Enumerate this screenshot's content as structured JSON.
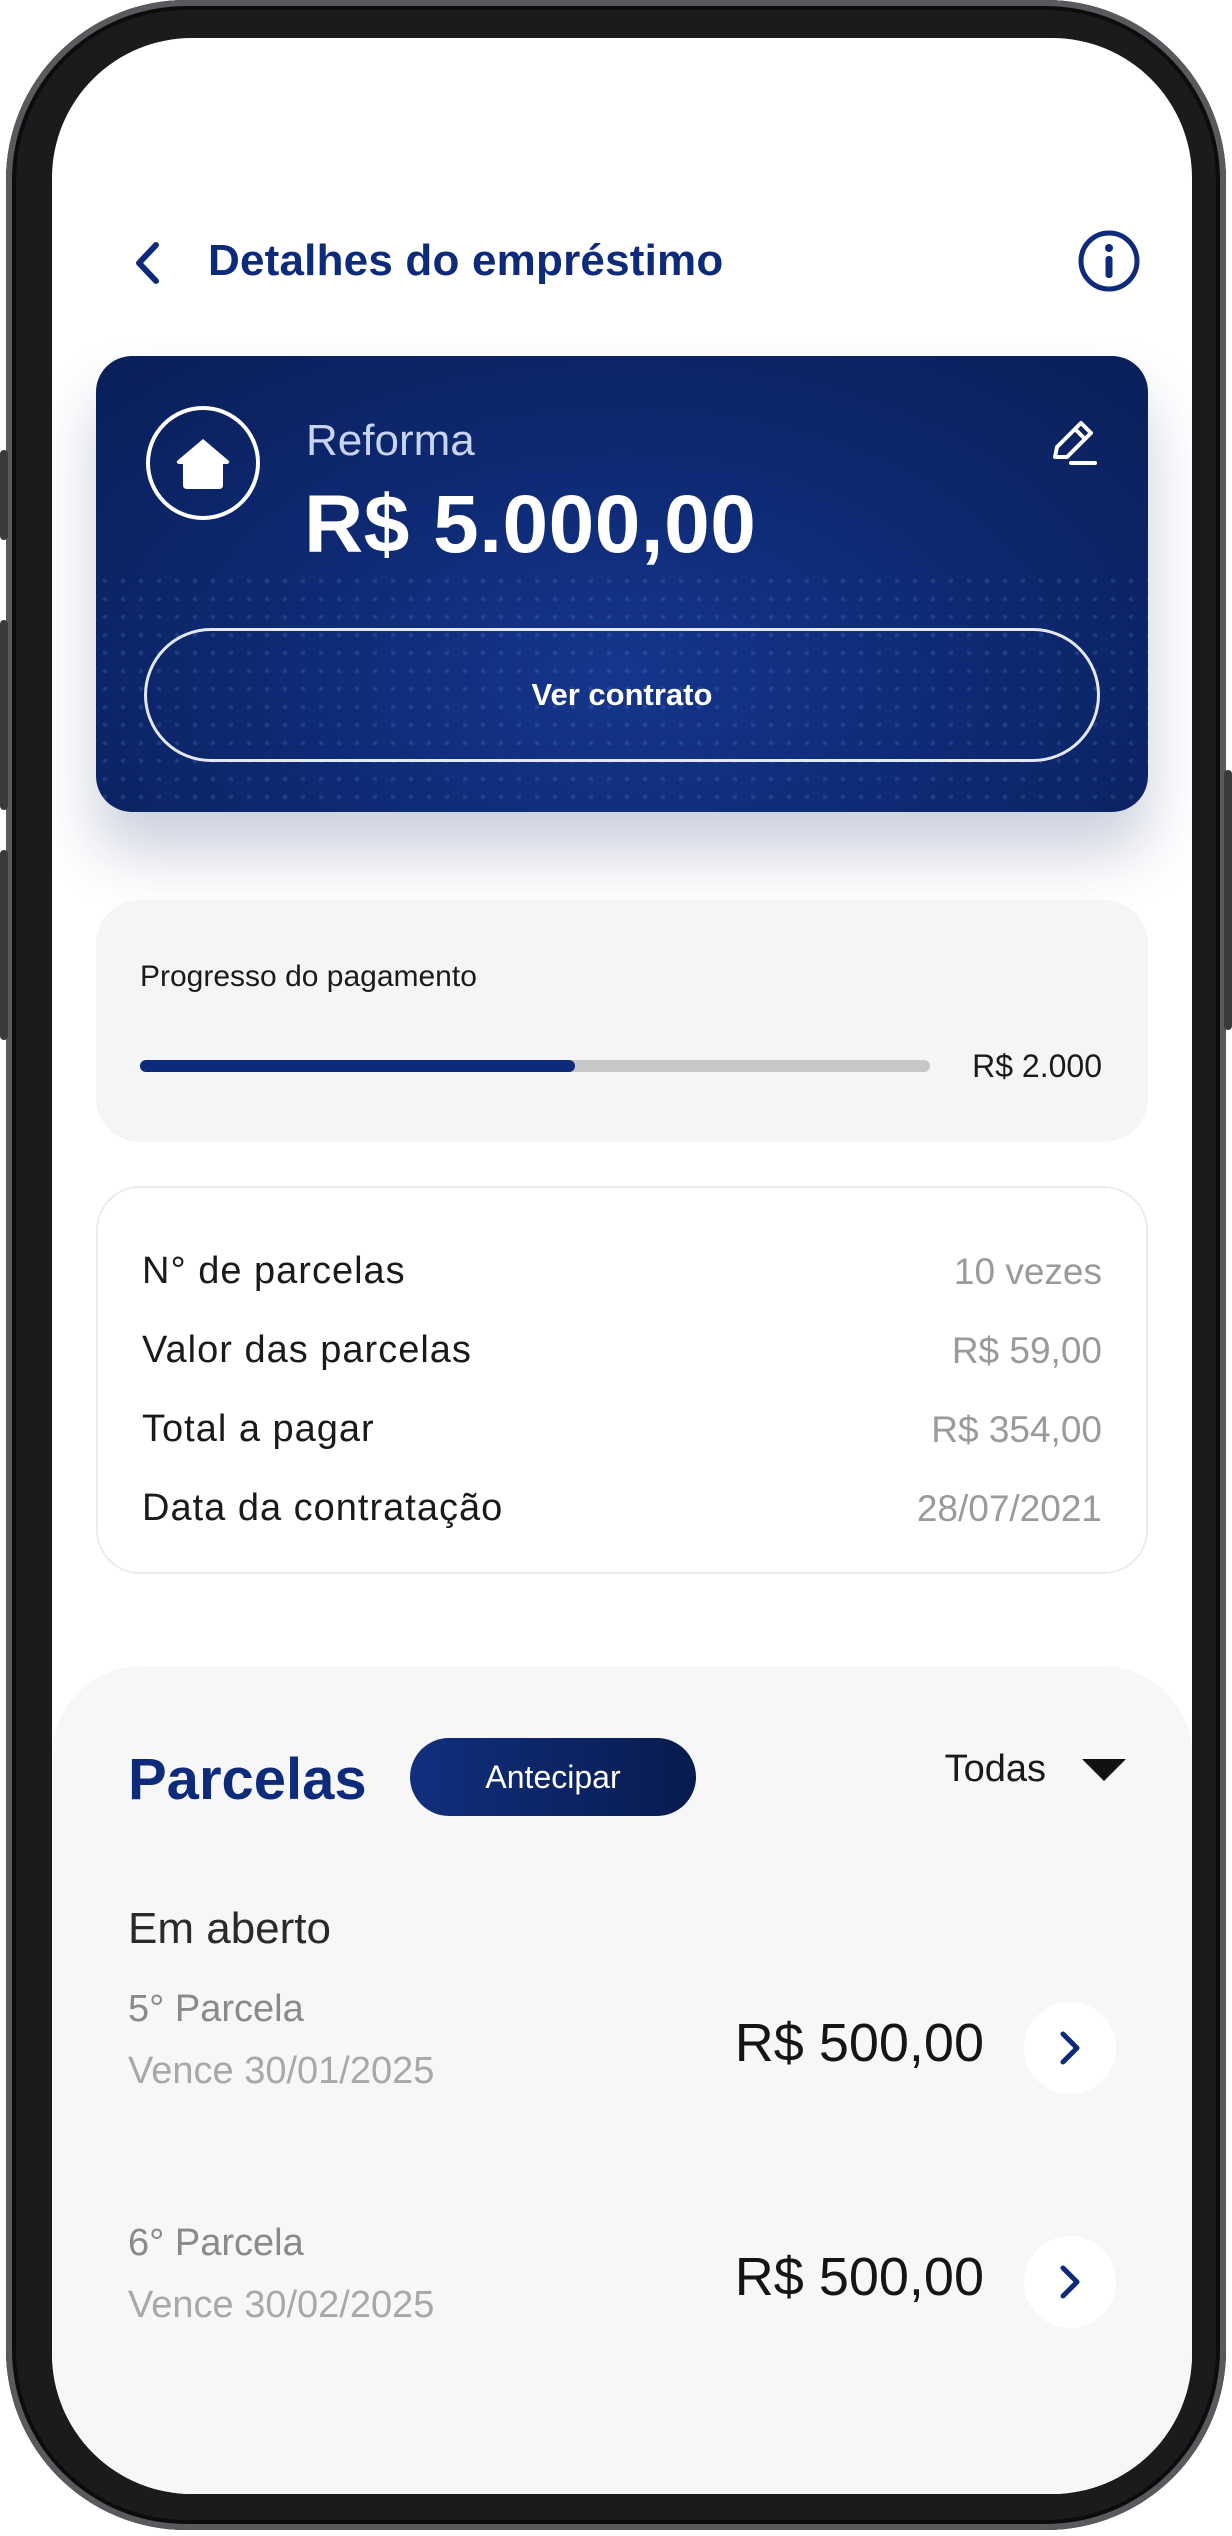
{
  "header": {
    "title": "Detalhes do empréstimo",
    "back_icon": "chevron-left-icon",
    "info_icon": "info-icon"
  },
  "loan": {
    "category": "Reforma",
    "amount": "R$ 5.000,00",
    "category_icon": "home-icon",
    "edit_icon": "pencil-icon",
    "contract_button": "Ver contrato"
  },
  "progress": {
    "title": "Progresso do pagamento",
    "fraction": 0.55,
    "value_label": "R$ 2.000"
  },
  "details": [
    {
      "label": "N° de parcelas",
      "value": "10 vezes"
    },
    {
      "label": "Valor das parcelas",
      "value": "R$ 59,00"
    },
    {
      "label": "Total a pagar",
      "value": "R$ 354,00"
    },
    {
      "label": "Data da contratação",
      "value": "28/07/2021"
    }
  ],
  "installments_section": {
    "title": "Parcelas",
    "anticipate_button": "Antecipar",
    "filter_label": "Todas",
    "group_label": "Em aberto",
    "items": [
      {
        "name": "5° Parcela",
        "due": "Vence 30/01/2025",
        "amount": "R$ 500,00"
      },
      {
        "name": "6° Parcela",
        "due": "Vence 30/02/2025",
        "amount": "R$ 500,00"
      }
    ]
  },
  "colors": {
    "brand": "#0d2b7a",
    "card_dark": "#0a1f58",
    "progress_track": "#c7c7c7"
  }
}
